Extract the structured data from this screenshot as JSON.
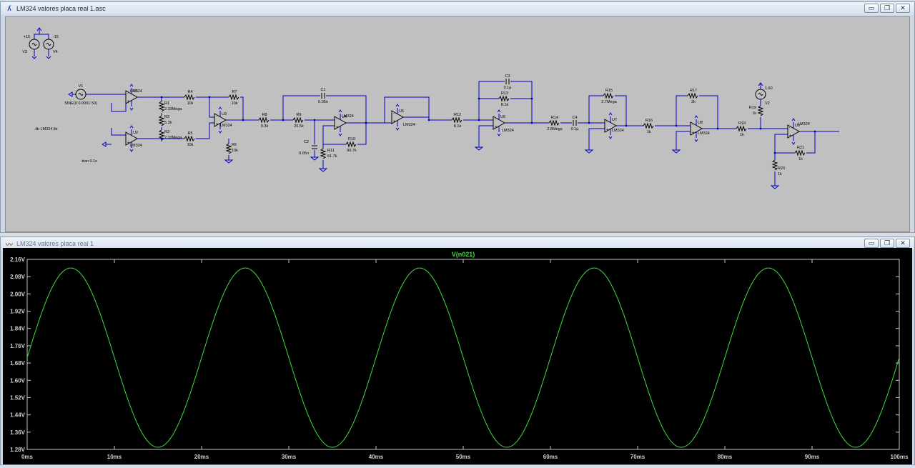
{
  "schematic_window": {
    "title": "LM324 valores placa real 1.asc",
    "components": [
      {
        "ref": "V3",
        "value": "+15"
      },
      {
        "ref": "V4",
        "value": "-15"
      },
      {
        "ref": "V1",
        "value": "SINE(0 0.0001 50)"
      },
      {
        "ref": "U1",
        "value": "LM324"
      },
      {
        "ref": "U2",
        "value": "LM324"
      },
      {
        "ref": "R1",
        "value": "2.33Mega"
      },
      {
        "ref": "R2",
        "value": "5.3k"
      },
      {
        "ref": "R3",
        "value": "2.33Mega"
      },
      {
        "ref": "R4",
        "value": "10k"
      },
      {
        "ref": "R5",
        "value": "10k"
      },
      {
        "ref": "R6",
        "value": "10k"
      },
      {
        "ref": "R7",
        "value": "10k"
      },
      {
        "ref": "U3",
        "value": "LM324"
      },
      {
        "ref": "R8",
        "value": "9.3k"
      },
      {
        "ref": "R9",
        "value": "26.5k"
      },
      {
        "ref": "C1",
        "value": "0.05n"
      },
      {
        "ref": "C2",
        "value": "0.05n"
      },
      {
        "ref": "U4",
        "value": "LM324"
      },
      {
        "ref": "R10",
        "value": "90.7k"
      },
      {
        "ref": "R11",
        "value": "61.7k"
      },
      {
        "ref": "U5",
        "value": "LM324"
      },
      {
        "ref": "R12",
        "value": "8.1k"
      },
      {
        "ref": "C3",
        "value": "0.1µ"
      },
      {
        "ref": "R13",
        "value": "8.1k"
      },
      {
        "ref": "U6",
        "value": "LM324"
      },
      {
        "ref": "R14",
        "value": "2.8Mega"
      },
      {
        "ref": "C4",
        "value": "0.1µ"
      },
      {
        "ref": "R15",
        "value": "2.7Mega"
      },
      {
        "ref": "U7",
        "value": "LM324"
      },
      {
        "ref": "R16",
        "value": "1k"
      },
      {
        "ref": "R17",
        "value": "2k"
      },
      {
        "ref": "U8",
        "value": "LM324"
      },
      {
        "ref": "R18",
        "value": "1k"
      },
      {
        "ref": "R19",
        "value": "1k"
      },
      {
        "ref": "V2",
        "value": "1.60"
      },
      {
        "ref": "U9",
        "value": "LM324"
      },
      {
        "ref": "R20",
        "value": "1k"
      },
      {
        "ref": "R21",
        "value": "1k"
      }
    ],
    "directives": [
      ".lib LM324.lib",
      ".tran 0.1s"
    ]
  },
  "plot_window": {
    "title": "LM324 valores placa real 1",
    "buttons": {
      "minimize": "▭",
      "restore": "❐",
      "close": "✕"
    }
  },
  "colors": {
    "trace": "#3fdc3f",
    "plot_background": "#000000",
    "axis_text": "#d0d0d0",
    "wire": "#0000c8",
    "schematic_background": "#c0c0c0"
  },
  "chart_data": {
    "type": "line",
    "title": "V(n021)",
    "xlabel": "",
    "ylabel": "",
    "x_ticks": [
      "0ms",
      "10ms",
      "20ms",
      "30ms",
      "40ms",
      "50ms",
      "60ms",
      "70ms",
      "80ms",
      "90ms",
      "100ms"
    ],
    "y_ticks": [
      "2.16V",
      "2.08V",
      "2.00V",
      "1.92V",
      "1.84V",
      "1.76V",
      "1.68V",
      "1.60V",
      "1.52V",
      "1.44V",
      "1.36V",
      "1.28V"
    ],
    "xlim": [
      0,
      100
    ],
    "ylim": [
      1.28,
      2.16
    ],
    "series": [
      {
        "name": "V(n021)",
        "waveform": "sine",
        "offset_V": 1.705,
        "amplitude_V": 0.415,
        "frequency_Hz": 50,
        "phase_deg": 0
      }
    ],
    "grid": false
  }
}
